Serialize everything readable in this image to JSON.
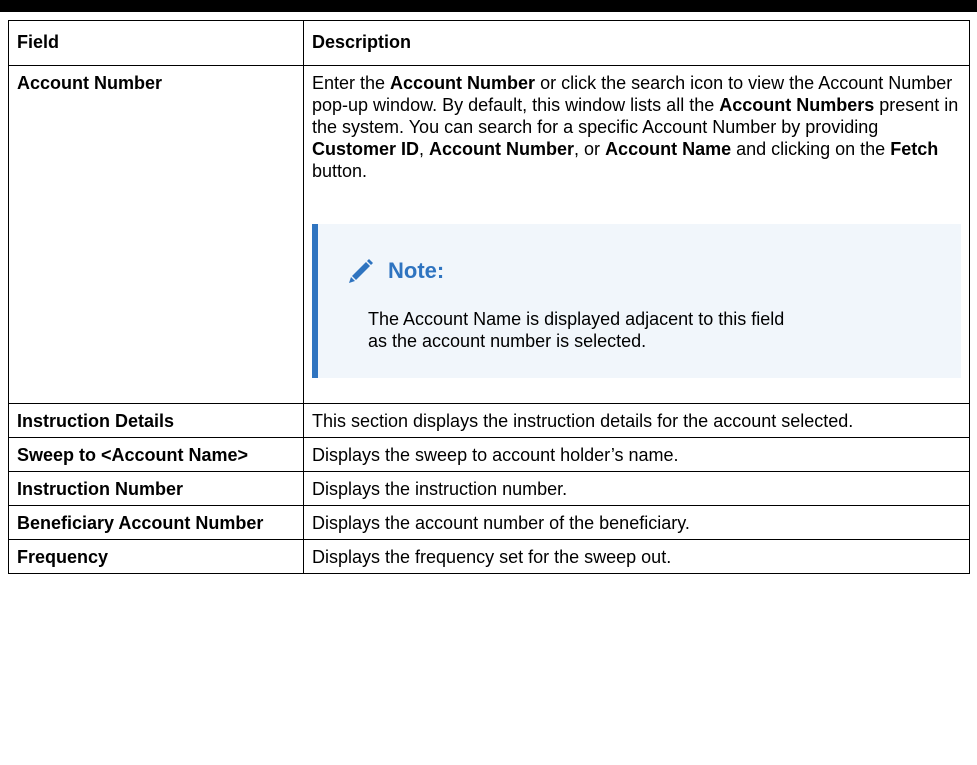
{
  "table": {
    "headers": [
      "Field",
      "Description"
    ],
    "account_row": {
      "field": "Account Number",
      "desc_parts": [
        "Enter the ",
        "Account Number",
        " or click the search icon to view the Account Number pop-up window. By default, this window lists all the ",
        "Account Numbers",
        " present in the system. You can search for a specific Account Number by providing ",
        "Customer ID",
        ", ",
        "Account Number",
        ", or ",
        "Account Name",
        " and clicking on the ",
        "Fetch",
        " button."
      ],
      "note_title": "Note:",
      "note_text": "The Account Name is displayed adjacent to this field as the account number is selected.",
      "note_icon": "pencil-icon",
      "note_accent": "#2f74c0",
      "note_bg": "#f1f6fb"
    },
    "rows": [
      {
        "field": "Instruction Details",
        "desc": "This section displays the instruction details for the account selected."
      },
      {
        "field": "Sweep to <Account Name>",
        "desc": "Displays the sweep to account holder’s name."
      },
      {
        "field": "Instruction Number",
        "desc": "Displays the instruction number."
      },
      {
        "field": "Beneficiary Account Number",
        "desc": "Displays the account number of the beneficiary."
      },
      {
        "field": "Frequency",
        "desc": "Displays the frequency set for the sweep out."
      }
    ]
  }
}
